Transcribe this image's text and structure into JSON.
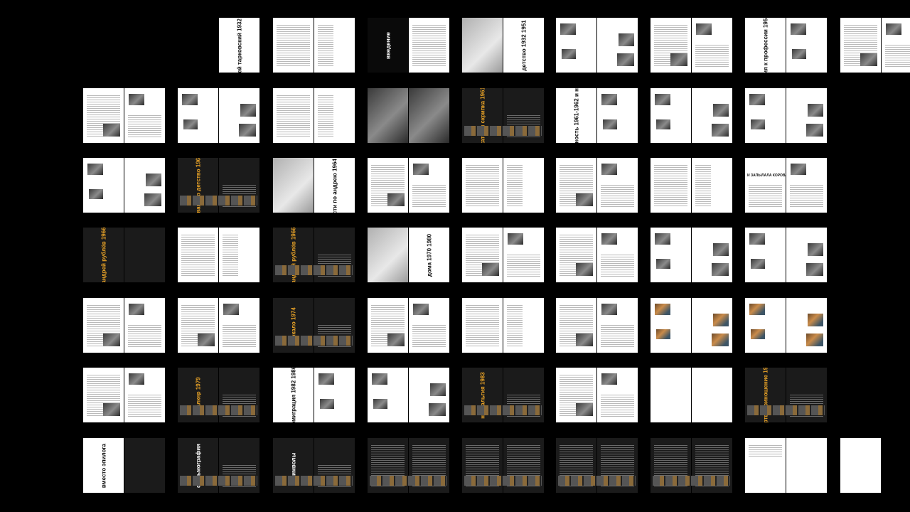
{
  "spreads": [
    {
      "row": 0,
      "col": 1,
      "layout": "title-white",
      "title": "андрей тарковский 1932 1986"
    },
    {
      "row": 0,
      "col": 2,
      "layout": "white-text-both"
    },
    {
      "row": 0,
      "col": 3,
      "layout": "dark-title-left",
      "title": "введение",
      "titleColor": "white"
    },
    {
      "row": 0,
      "col": 4,
      "layout": "photo-left-title",
      "title": "детство 1932 1951"
    },
    {
      "row": 0,
      "col": 5,
      "layout": "photos-both"
    },
    {
      "row": 0,
      "col": 6,
      "layout": "text-photos"
    },
    {
      "row": 0,
      "col": 7,
      "layout": "title-white-photos",
      "title": "история к профессии 1953 1956"
    },
    {
      "row": 0,
      "col": 8,
      "layout": "text-photos"
    },
    {
      "row": 1,
      "col": 0,
      "layout": "text-photos"
    },
    {
      "row": 1,
      "col": 1,
      "layout": "photos-both"
    },
    {
      "row": 1,
      "col": 2,
      "layout": "white-text-both"
    },
    {
      "row": 1,
      "col": 3,
      "layout": "photo-full-dark"
    },
    {
      "row": 1,
      "col": 4,
      "layout": "dark-strip-title",
      "title": "каток и скрипка 1961"
    },
    {
      "row": 1,
      "col": 5,
      "layout": "title-white-photos",
      "title": "счастливая случайность 1961-1962 и неожиданный успех"
    },
    {
      "row": 1,
      "col": 6,
      "layout": "photos-both"
    },
    {
      "row": 1,
      "col": 7,
      "layout": "photos-both"
    },
    {
      "row": 2,
      "col": 0,
      "layout": "photos-both"
    },
    {
      "row": 2,
      "col": 1,
      "layout": "dark-strip-title",
      "title": "иваново детство 1962"
    },
    {
      "row": 2,
      "col": 2,
      "layout": "photo-left-title",
      "title": "страсти по андрею 1964 1971"
    },
    {
      "row": 2,
      "col": 3,
      "layout": "text-photos"
    },
    {
      "row": 2,
      "col": 4,
      "layout": "white-text-both"
    },
    {
      "row": 2,
      "col": 5,
      "layout": "text-photos"
    },
    {
      "row": 2,
      "col": 6,
      "layout": "white-text-both"
    },
    {
      "row": 2,
      "col": 7,
      "layout": "newspaper",
      "title": "И ЗАПЫЛАЛА КОРОВА"
    },
    {
      "row": 3,
      "col": 0,
      "layout": "dark-title-left",
      "title": "андрей рублёв 1966"
    },
    {
      "row": 3,
      "col": 1,
      "layout": "white-text-both"
    },
    {
      "row": 3,
      "col": 2,
      "layout": "dark-strip-title",
      "title": "андрей рублёв 1966"
    },
    {
      "row": 3,
      "col": 3,
      "layout": "photo-left-title",
      "title": "дома 1970 1980"
    },
    {
      "row": 3,
      "col": 4,
      "layout": "text-photos"
    },
    {
      "row": 3,
      "col": 5,
      "layout": "text-photos"
    },
    {
      "row": 3,
      "col": 6,
      "layout": "photos-both"
    },
    {
      "row": 3,
      "col": 7,
      "layout": "photos-both"
    },
    {
      "row": 4,
      "col": 0,
      "layout": "text-photos"
    },
    {
      "row": 4,
      "col": 1,
      "layout": "text-photos"
    },
    {
      "row": 4,
      "col": 2,
      "layout": "dark-strip-title",
      "title": "зеркало 1974"
    },
    {
      "row": 4,
      "col": 3,
      "layout": "text-photos"
    },
    {
      "row": 4,
      "col": 4,
      "layout": "white-text-both"
    },
    {
      "row": 4,
      "col": 5,
      "layout": "text-photos"
    },
    {
      "row": 4,
      "col": 6,
      "layout": "color-photos"
    },
    {
      "row": 4,
      "col": 7,
      "layout": "color-photos"
    },
    {
      "row": 5,
      "col": 0,
      "layout": "text-photos"
    },
    {
      "row": 5,
      "col": 1,
      "layout": "dark-strip-title",
      "title": "сталкер 1979"
    },
    {
      "row": 5,
      "col": 2,
      "layout": "title-white-photos",
      "title": "эмиграция 1982 1986"
    },
    {
      "row": 5,
      "col": 3,
      "layout": "photos-both"
    },
    {
      "row": 5,
      "col": 4,
      "layout": "dark-strip-title",
      "title": "ностальгия 1983"
    },
    {
      "row": 5,
      "col": 5,
      "layout": "text-photos"
    },
    {
      "row": 5,
      "col": 6,
      "layout": "blank-white"
    },
    {
      "row": 5,
      "col": 7,
      "layout": "dark-strip-title",
      "title": "жертвоприношение 1986"
    },
    {
      "row": 6,
      "col": 0,
      "layout": "afterword",
      "title": "вместо эпилога"
    },
    {
      "row": 6,
      "col": 1,
      "layout": "dark-strip-title",
      "title": "фильмография",
      "titleColor": "white"
    },
    {
      "row": 6,
      "col": 2,
      "layout": "dark-strip-title",
      "title": "символы",
      "titleColor": "white"
    },
    {
      "row": 6,
      "col": 3,
      "layout": "dark-strip"
    },
    {
      "row": 6,
      "col": 4,
      "layout": "dark-strip"
    },
    {
      "row": 6,
      "col": 5,
      "layout": "dark-strip"
    },
    {
      "row": 6,
      "col": 6,
      "layout": "dark-strip"
    },
    {
      "row": 6,
      "col": 7,
      "layout": "colophon"
    },
    {
      "row": 6,
      "col": 8,
      "layout": "back-cover"
    }
  ]
}
